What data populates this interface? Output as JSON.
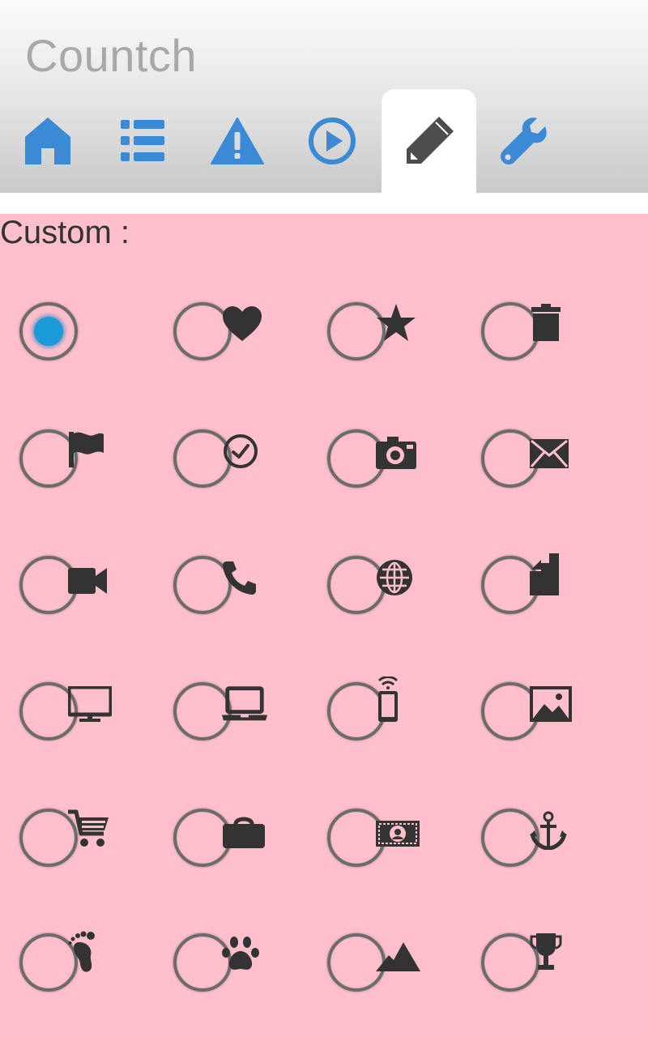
{
  "app": {
    "title": "Countch"
  },
  "tabs": [
    {
      "icon": "home-icon",
      "active": false
    },
    {
      "icon": "list-icon",
      "active": false
    },
    {
      "icon": "warning-icon",
      "active": false
    },
    {
      "icon": "play-circle-icon",
      "active": false
    },
    {
      "icon": "pencil-icon",
      "active": true
    },
    {
      "icon": "wrench-icon",
      "active": false
    }
  ],
  "colors": {
    "accent": "#3a8ad6",
    "content_bg": "#ffc0cb",
    "radio_selected": "#1a9ad6",
    "icon": "#333333"
  },
  "custom": {
    "label": "Custom :",
    "selected_index": 0,
    "options": [
      {
        "icon": "none"
      },
      {
        "icon": "heart-icon"
      },
      {
        "icon": "star-icon"
      },
      {
        "icon": "trash-icon"
      },
      {
        "icon": "flag-icon"
      },
      {
        "icon": "clock-icon"
      },
      {
        "icon": "camera-icon"
      },
      {
        "icon": "envelope-icon"
      },
      {
        "icon": "video-camera-icon"
      },
      {
        "icon": "phone-icon"
      },
      {
        "icon": "globe-icon"
      },
      {
        "icon": "sim-card-icon"
      },
      {
        "icon": "monitor-icon"
      },
      {
        "icon": "laptop-icon"
      },
      {
        "icon": "remote-icon"
      },
      {
        "icon": "picture-icon"
      },
      {
        "icon": "shopping-cart-icon"
      },
      {
        "icon": "briefcase-icon"
      },
      {
        "icon": "money-icon"
      },
      {
        "icon": "anchor-icon"
      },
      {
        "icon": "footprint-icon"
      },
      {
        "icon": "paw-icon"
      },
      {
        "icon": "mountain-icon"
      },
      {
        "icon": "trophy-icon"
      }
    ]
  }
}
